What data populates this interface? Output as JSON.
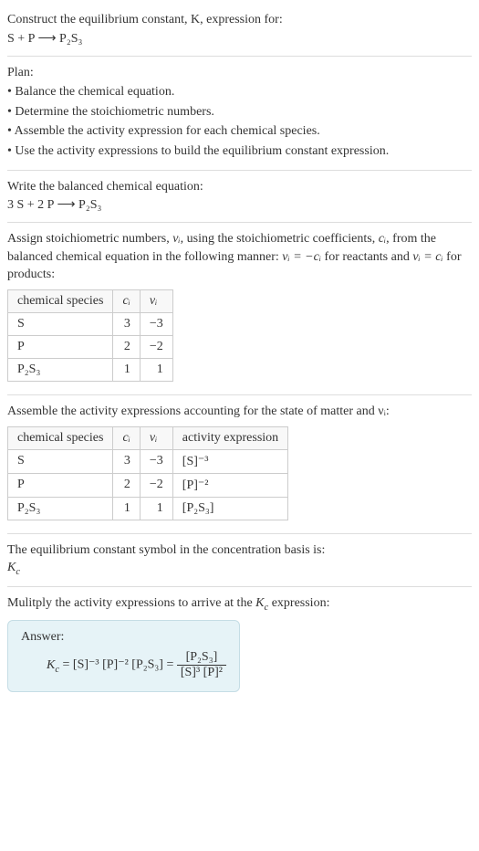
{
  "intro": {
    "line1": "Construct the equilibrium constant, K, expression for:",
    "eq_unbalanced_lhs": "S + P",
    "arrow": "⟶",
    "product": "P₂S₃"
  },
  "plan": {
    "heading": "Plan:",
    "b1": "• Balance the chemical equation.",
    "b2": "• Determine the stoichiometric numbers.",
    "b3": "• Assemble the activity expression for each chemical species.",
    "b4": "• Use the activity expressions to build the equilibrium constant expression."
  },
  "balanced": {
    "heading": "Write the balanced chemical equation:",
    "lhs": "3 S + 2 P",
    "arrow": "⟶",
    "rhs": "P₂S₃"
  },
  "stoich": {
    "text_a": "Assign stoichiometric numbers, ",
    "nu": "νᵢ",
    "text_b": ", using the stoichiometric coefficients, ",
    "ci": "cᵢ",
    "text_c": ", from the balanced chemical equation in the following manner: ",
    "rel_reactants": "νᵢ = −cᵢ",
    "text_d": " for reactants and ",
    "rel_products": "νᵢ = cᵢ",
    "text_e": " for products:"
  },
  "table1": {
    "h1": "chemical species",
    "h2": "cᵢ",
    "h3": "νᵢ",
    "rows": [
      {
        "sp": "S",
        "ci": "3",
        "nu": "−3"
      },
      {
        "sp": "P",
        "ci": "2",
        "nu": "−2"
      },
      {
        "sp": "P₂S₃",
        "ci": "1",
        "nu": "1"
      }
    ]
  },
  "activity_intro": "Assemble the activity expressions accounting for the state of matter and νᵢ:",
  "table2": {
    "h1": "chemical species",
    "h2": "cᵢ",
    "h3": "νᵢ",
    "h4": "activity expression",
    "rows": [
      {
        "sp": "S",
        "ci": "3",
        "nu": "−3",
        "act": "[S]⁻³"
      },
      {
        "sp": "P",
        "ci": "2",
        "nu": "−2",
        "act": "[P]⁻²"
      },
      {
        "sp": "P₂S₃",
        "ci": "1",
        "nu": "1",
        "act": "[P₂S₃]"
      }
    ]
  },
  "symbol_text": "The equilibrium constant symbol in the concentration basis is:",
  "symbol_kc": "K_c",
  "multiply_text": "Mulitply the activity expressions to arrive at the K_c expression:",
  "answer": {
    "label": "Answer:",
    "kc": "K_c",
    "eq1_part1": " = [S]⁻³ [P]⁻² [P₂S₃] = ",
    "frac_top": "[P₂S₃]",
    "frac_bot": "[S]³ [P]²"
  }
}
